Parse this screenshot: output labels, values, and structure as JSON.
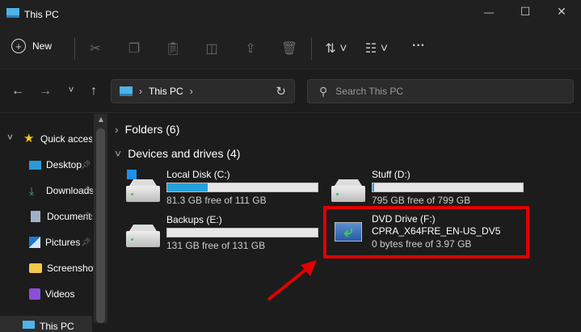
{
  "window": {
    "title": "This PC",
    "minimize": "—",
    "maximize": "☐",
    "close": "✕"
  },
  "toolbar": {
    "new_label": "New"
  },
  "nav": {
    "breadcrumb": "This PC",
    "search_placeholder": "Search This PC"
  },
  "sidebar": {
    "quick_access": "Quick access",
    "items": [
      {
        "label": "Desktop",
        "pinned": true
      },
      {
        "label": "Downloads",
        "pinned": true
      },
      {
        "label": "Documents",
        "pinned": true
      },
      {
        "label": "Pictures",
        "pinned": true
      },
      {
        "label": "Screenshots",
        "pinned": false
      },
      {
        "label": "Videos",
        "pinned": false
      }
    ],
    "this_pc": "This PC"
  },
  "main": {
    "folders": "Folders (6)",
    "devices": "Devices and drives (4)",
    "drives": [
      {
        "name": "Local Disk (C:)",
        "free": "81.3 GB free of 111 GB",
        "used_percent": 26.8
      },
      {
        "name": "Stuff (D:)",
        "free": "795 GB free of 799 GB",
        "used_percent": 1
      },
      {
        "name": "Backups (E:)",
        "free": "131 GB free of 131 GB",
        "used_percent": 0
      },
      {
        "name": "DVD Drive (F:)",
        "label": "CPRA_X64FRE_EN-US_DV5",
        "free": "0 bytes free of 3.97 GB"
      }
    ]
  },
  "colors": {
    "highlight": "#e00000",
    "accent": "#26a0da"
  }
}
